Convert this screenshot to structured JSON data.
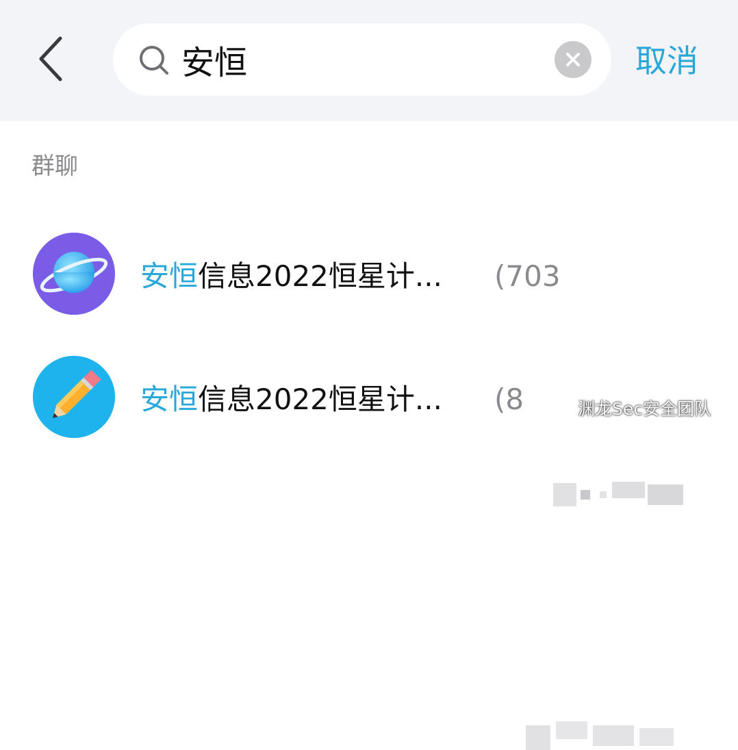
{
  "search": {
    "query": "安恒",
    "cancel_label": "取消"
  },
  "section": {
    "label": "群聊"
  },
  "results": [
    {
      "highlight": "安恒",
      "rest": "信息2022恒星计...",
      "id_visible": "(703"
    },
    {
      "highlight": "安恒",
      "rest": "信息2022恒星计...",
      "id_visible": "(8"
    }
  ],
  "watermark": "渊龙Sec安全团队",
  "colors": {
    "accent": "#2aa7d9",
    "header_bg": "#f3f4f7",
    "muted_text": "#8a8a8e"
  }
}
